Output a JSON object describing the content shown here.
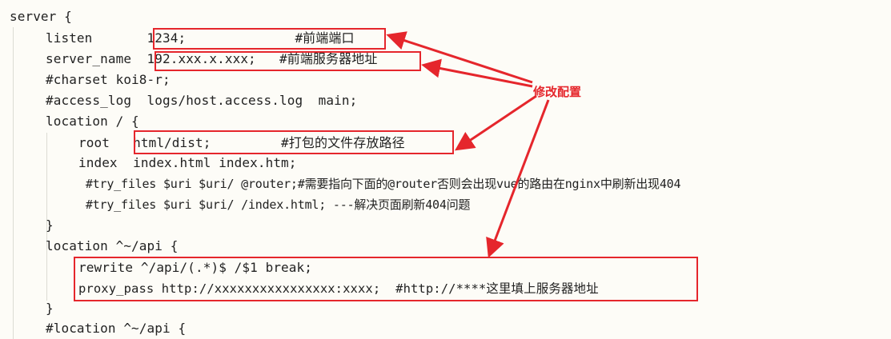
{
  "code": {
    "lines": [
      "server {",
      "listen       1234;              #前端端口",
      "server_name  192.xxx.x.xxx;   #前端服务器地址",
      "#charset koi8-r;",
      "#access_log  logs/host.access.log  main;",
      "location / {",
      "root   html/dist;         #打包的文件存放路径",
      "index  index.html index.htm;",
      " #try_files $uri $uri/ @router;#需要指向下面的@router否则会出现vue的路由在nginx中刷新出现404",
      " #try_files $uri $uri/ /index.html; ---解决页面刷新404问题",
      "}",
      "location ^~/api {",
      "rewrite ^/api/(.*)$ /$1 break;",
      "proxy_pass http://xxxxxxxxxxxxxxxx:xxxx;  #http://****这里填上服务器地址",
      "}",
      "#location ^~/api {"
    ]
  },
  "annotation": {
    "label": "修改配置",
    "color": "#e5262c"
  }
}
